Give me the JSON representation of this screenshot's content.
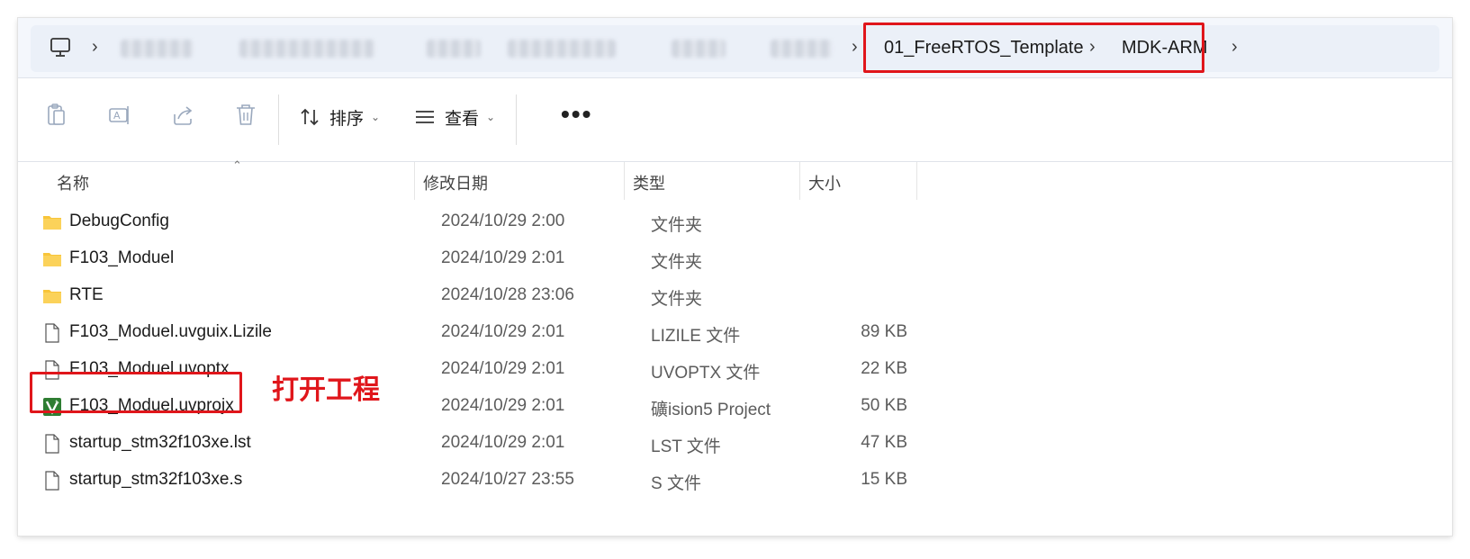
{
  "address": {
    "segments_visible": [
      "01_FreeRTOS_Template",
      "MDK-ARM"
    ]
  },
  "toolbar": {
    "sort_label": "排序",
    "view_label": "查看",
    "more_label": "•••"
  },
  "columns": {
    "name": "名称",
    "date": "修改日期",
    "type": "类型",
    "size": "大小"
  },
  "files": [
    {
      "name": "DebugConfig",
      "date": "2024/10/29 2:00",
      "type": "文件夹",
      "size": "",
      "icon": "folder"
    },
    {
      "name": "F103_Moduel",
      "date": "2024/10/29 2:01",
      "type": "文件夹",
      "size": "",
      "icon": "folder"
    },
    {
      "name": "RTE",
      "date": "2024/10/28 23:06",
      "type": "文件夹",
      "size": "",
      "icon": "folder"
    },
    {
      "name": "F103_Moduel.uvguix.Lizile",
      "date": "2024/10/29 2:01",
      "type": "LIZILE 文件",
      "size": "89 KB",
      "icon": "file"
    },
    {
      "name": "F103_Moduel.uvoptx",
      "date": "2024/10/29 2:01",
      "type": "UVOPTX 文件",
      "size": "22 KB",
      "icon": "file"
    },
    {
      "name": "F103_Moduel.uvprojx",
      "date": "2024/10/29 2:01",
      "type": "礦ision5 Project",
      "size": "50 KB",
      "icon": "keil-project"
    },
    {
      "name": "startup_stm32f103xe.lst",
      "date": "2024/10/29 2:01",
      "type": "LST 文件",
      "size": "47 KB",
      "icon": "file"
    },
    {
      "name": "startup_stm32f103xe.s",
      "date": "2024/10/27 23:55",
      "type": "S 文件",
      "size": "15 KB",
      "icon": "file"
    }
  ],
  "annotation": {
    "text": "打开工程",
    "color": "#e0161b"
  },
  "colors": {
    "folder": "#f8c53a",
    "accent_red": "#e0161b",
    "keil_green": "#2e7d32"
  }
}
